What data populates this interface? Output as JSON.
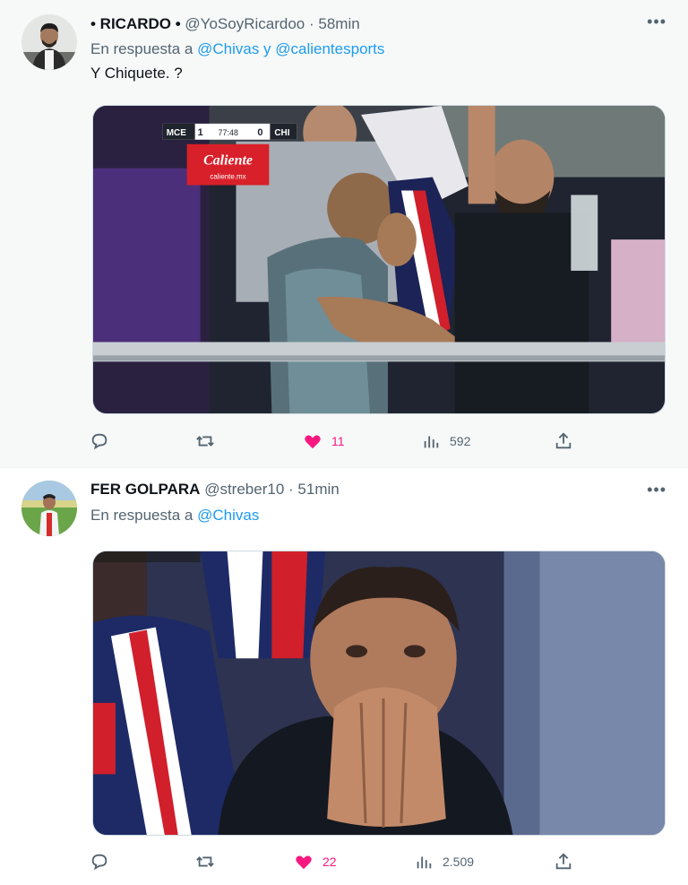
{
  "tweets": [
    {
      "name": "• RICARDO •",
      "handle": "@YoSoyRicardoo",
      "sep": "·",
      "time": "58min",
      "reply_prefix": "En respuesta a",
      "reply_mentions": "@Chivas y @calientesports",
      "text": "Y Chiquete. ?",
      "media": {
        "scoreboard": {
          "home": "MCE",
          "home_score": "1",
          "away": "CHI",
          "away_score": "0",
          "clock": "77:48"
        },
        "sponsor": "Caliente",
        "sponsor_sub": "caliente.mx"
      },
      "actions": {
        "replies": "",
        "retweets": "",
        "likes": "11",
        "views": "592"
      }
    },
    {
      "name": "FER GOLPARA",
      "handle": "@streber10",
      "sep": "·",
      "time": "51min",
      "reply_prefix": "En respuesta a",
      "reply_mentions": "@Chivas",
      "text": "",
      "actions": {
        "replies": "",
        "retweets": "",
        "likes": "22",
        "views": "2.509"
      }
    }
  ],
  "icons": [
    "reply-icon",
    "retweet-icon",
    "like-icon",
    "views-icon",
    "share-icon",
    "more-icon"
  ],
  "colors": {
    "accent": "#1d9bf0",
    "like": "#f91880",
    "meta": "#536471"
  }
}
